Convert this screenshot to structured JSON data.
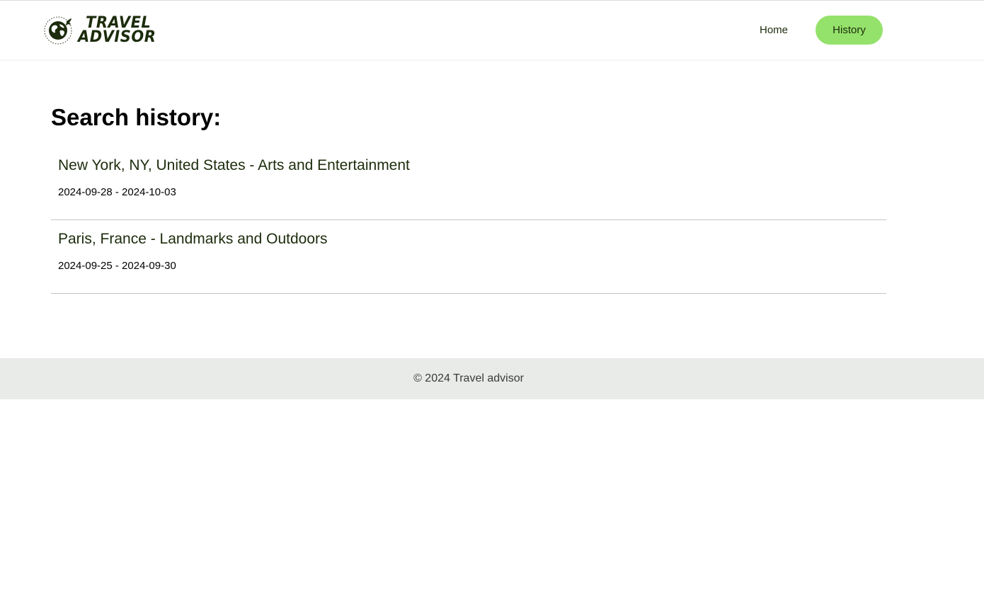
{
  "header": {
    "logo": {
      "line1": "TRAVEL",
      "line2": "ADVISOR",
      "icon": "globe-airplane-icon"
    },
    "nav": {
      "home_label": "Home",
      "history_label": "History",
      "active": "History"
    }
  },
  "main": {
    "title": "Search history:",
    "items": [
      {
        "title": "New York, NY, United States - Arts and Entertainment",
        "dates": "2024-09-28 - 2024-10-03"
      },
      {
        "title": "Paris, France - Landmarks and Outdoors",
        "dates": "2024-09-25 - 2024-09-30"
      }
    ]
  },
  "footer": {
    "text": "© 2024 Travel advisor"
  },
  "colors": {
    "accent": "#94e26b",
    "text_dark_green": "#1c2c0c",
    "footer_bg": "#e9ebe8",
    "divider": "#c4c4c4"
  }
}
